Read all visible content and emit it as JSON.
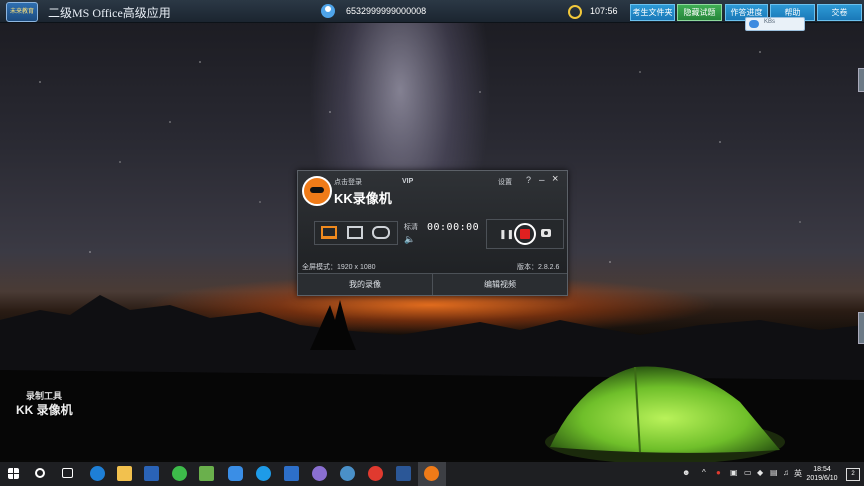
{
  "topbar": {
    "logo_text": "未来教育",
    "title": "二级MS Office高级应用",
    "user_id": "6532999999000008",
    "timer": "107:56",
    "buttons": [
      "考生文件夹",
      "隐藏试题",
      "作答进度",
      "帮助",
      "交卷"
    ],
    "cloud_popup": "KBs"
  },
  "recorder": {
    "login_label": "点击登录",
    "vip_label": "VIP",
    "app_name": "KK录像机",
    "settings_label": "设置",
    "help_label": "?",
    "minimize_label": "–",
    "close_label": "×",
    "quality_label": "标清",
    "time": "00:00:00",
    "mode_info": "全屏模式：1920 x 1080",
    "version": "版本：2.8.2.6",
    "tab_recordings": "我的录像",
    "tab_edit": "编辑视频",
    "icons": [
      "screen-mode-icon",
      "window-mode-icon",
      "game-mode-icon",
      "pause-icon",
      "record-icon",
      "camera-icon",
      "speaker-icon"
    ]
  },
  "watermark": {
    "line1": "录制工具",
    "line2": "KK 录像机"
  },
  "taskbar": {
    "clock_time": "18:54",
    "clock_date": "2019/6/10",
    "ime": "英",
    "notification_count": "2",
    "apps": [
      "start-icon",
      "cortana-icon",
      "task-view-icon",
      "edge-icon",
      "file-explorer-icon",
      "app-s-icon",
      "app-green-icon",
      "app-doc-icon",
      "app-blue1-icon",
      "app-blue2-icon",
      "app-calc-icon",
      "app-rec-icon",
      "app-globe-icon",
      "netease-icon",
      "word-icon",
      "kk-recorder-icon"
    ]
  },
  "colors": {
    "accent_blue": "#1a79b8",
    "accent_green": "#26863a",
    "record_red": "#e02020",
    "kk_orange": "#f07b18"
  }
}
